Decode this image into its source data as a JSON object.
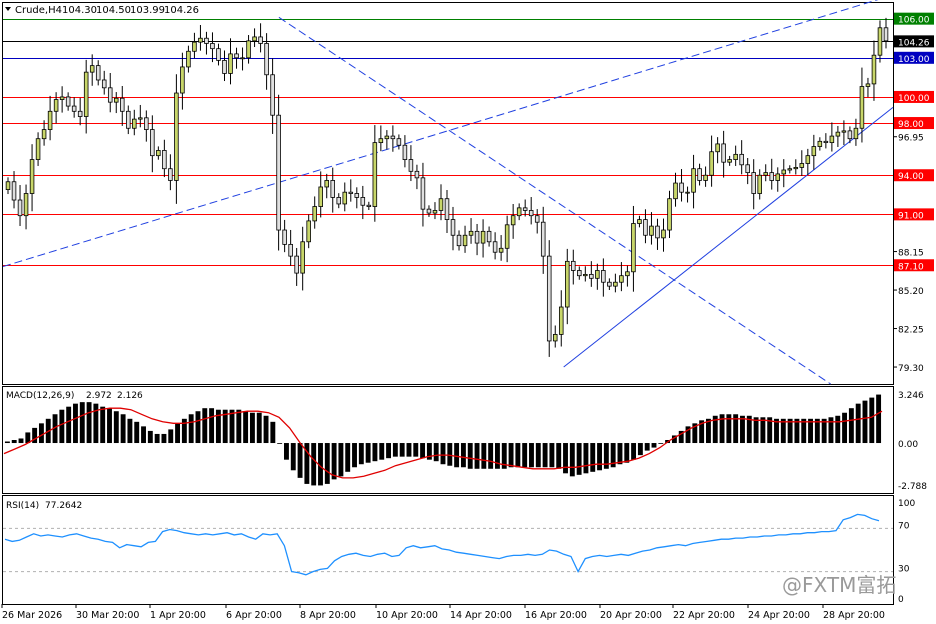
{
  "header": {
    "symbol": "Crude,H4",
    "open": "104.30",
    "high": "104.50",
    "low": "103.99",
    "close": "104.26"
  },
  "watermark": "@FXTM富拓",
  "colors": {
    "bull_body": "#c8d66a",
    "bear_body": "#e0e0e0",
    "candle_outline": "#000000",
    "level_red": "#ff0000",
    "level_blue": "#0000c0",
    "level_green": "#008000",
    "trend_blue": "#2040e0",
    "macd_signal": "#e00000",
    "rsi_line": "#1e90ff"
  },
  "chart_data": [
    {
      "type": "candlestick",
      "title": "Crude,H4",
      "ylim": [
        78.0,
        107.2
      ],
      "y_ticks": [
        "96.95",
        "88.15",
        "85.20",
        "82.25",
        "79.30"
      ],
      "x_ticks": [
        "26 Mar 2026",
        "30 Mar 20:00",
        "1 Apr 20:00",
        "6 Apr 20:00",
        "8 Apr 20:00",
        "10 Apr 20:00",
        "14 Apr 20:00",
        "16 Apr 20:00",
        "20 Apr 20:00",
        "22 Apr 20:00",
        "24 Apr 20:00",
        "28 Apr 20:00"
      ],
      "levels": [
        {
          "value": 106.0,
          "label": "106.00",
          "color": "green"
        },
        {
          "value": 104.26,
          "label": "104.26",
          "color": "black"
        },
        {
          "value": 103.0,
          "label": "103.00",
          "color": "blue"
        },
        {
          "value": 100.0,
          "label": "100.00",
          "color": "red"
        },
        {
          "value": 98.0,
          "label": "98.00",
          "color": "red"
        },
        {
          "value": 94.0,
          "label": "94.00",
          "color": "red"
        },
        {
          "value": 91.0,
          "label": "91.00",
          "color": "red"
        },
        {
          "value": 87.1,
          "label": "87.10",
          "color": "red"
        }
      ],
      "trendlines": [
        {
          "style": "dashed",
          "from": [
            0,
            87.0
          ],
          "to": [
            0.985,
            107.5
          ]
        },
        {
          "style": "dashed",
          "from": [
            0.31,
            106.1
          ],
          "to": [
            0.93,
            78.0
          ]
        },
        {
          "style": "solid",
          "from": [
            0.63,
            79.3
          ],
          "to": [
            1.0,
            99.2
          ]
        }
      ],
      "closes": [
        93.5,
        92.1,
        90.9,
        92.6,
        95.2,
        96.8,
        97.5,
        98.9,
        99.8,
        100.0,
        99.3,
        98.9,
        98.5,
        101.9,
        102.4,
        101.3,
        100.7,
        99.6,
        99.9,
        98.9,
        97.6,
        98.3,
        98.4,
        97.5,
        95.5,
        95.9,
        94.5,
        93.6,
        100.3,
        102.3,
        103.5,
        104.2,
        104.5,
        104.1,
        103.7,
        102.8,
        101.8,
        103.3,
        103.0,
        103.0,
        104.3,
        104.6,
        104.1,
        101.7,
        98.6,
        89.8,
        88.7,
        87.8,
        86.5,
        88.9,
        90.5,
        91.6,
        93.1,
        93.6,
        92.3,
        91.8,
        92.7,
        92.6,
        92.3,
        91.7,
        91.6,
        96.5,
        96.8,
        97.0,
        96.8,
        96.3,
        95.2,
        94.3,
        93.8,
        91.4,
        91.1,
        91.3,
        92.2,
        90.6,
        89.4,
        88.6,
        89.4,
        89.7,
        88.8,
        89.7,
        88.9,
        88.1,
        88.4,
        90.2,
        90.9,
        91.5,
        91.3,
        90.9,
        90.4,
        87.8,
        81.3,
        81.8,
        83.9,
        87.4,
        86.7,
        86.3,
        86.4,
        86.1,
        86.7,
        85.8,
        85.5,
        85.8,
        86.3,
        86.6,
        90.3,
        90.6,
        89.4,
        90.1,
        89.2,
        89.8,
        92.2,
        93.4,
        92.7,
        92.7,
        94.5,
        93.6,
        94.0,
        95.8,
        96.4,
        95.0,
        95.2,
        95.6,
        94.8,
        94.2,
        92.6,
        94.0,
        94.2,
        93.6,
        94.1,
        94.4,
        94.5,
        94.6,
        94.9,
        95.5,
        96.2,
        96.6,
        96.5,
        97.0,
        97.3,
        97.4,
        96.8,
        97.6,
        100.8,
        101.0,
        103.2,
        105.3,
        104.3
      ]
    },
    {
      "type": "bar",
      "title": "MACD(12,26,9)",
      "main_value": "2.972",
      "signal_value": "2.126",
      "ylim": [
        -3.3,
        3.7
      ],
      "y_ticks": [
        "3.246",
        "0.00",
        "-2.788"
      ],
      "series": [
        {
          "name": "MACD",
          "values": [
            0.1,
            0.2,
            0.3,
            0.7,
            1.0,
            1.3,
            1.6,
            1.9,
            2.2,
            2.4,
            2.6,
            2.7,
            2.7,
            2.6,
            2.4,
            2.3,
            2.1,
            1.9,
            1.6,
            1.4,
            1.1,
            0.8,
            0.6,
            0.6,
            0.9,
            1.3,
            1.6,
            1.9,
            2.1,
            2.3,
            2.3,
            2.2,
            2.2,
            2.2,
            2.2,
            2.1,
            2.0,
            2.0,
            1.8,
            1.4,
            0.0,
            -1.1,
            -1.8,
            -2.3,
            -2.7,
            -2.8,
            -2.8,
            -2.7,
            -2.4,
            -2.2,
            -1.9,
            -1.6,
            -1.4,
            -1.3,
            -1.2,
            -1.1,
            -1.0,
            -0.9,
            -0.9,
            -0.9,
            -0.9,
            -1.0,
            -1.1,
            -1.2,
            -1.4,
            -1.5,
            -1.6,
            -1.6,
            -1.7,
            -1.7,
            -1.7,
            -1.7,
            -1.7,
            -1.7,
            -1.6,
            -1.6,
            -1.6,
            -1.6,
            -1.6,
            -1.6,
            -1.6,
            -1.7,
            -2.0,
            -2.2,
            -2.1,
            -2.0,
            -1.9,
            -1.8,
            -1.7,
            -1.6,
            -1.4,
            -1.3,
            -1.1,
            -0.8,
            -0.5,
            -0.3,
            0.0,
            0.2,
            0.5,
            0.8,
            1.1,
            1.3,
            1.5,
            1.6,
            1.8,
            1.9,
            1.9,
            1.9,
            1.8,
            1.8,
            1.7,
            1.7,
            1.7,
            1.6,
            1.6,
            1.6,
            1.6,
            1.6,
            1.6,
            1.6,
            1.6,
            1.7,
            1.8,
            2.0,
            2.3,
            2.6,
            2.8,
            3.0,
            3.2
          ]
        },
        {
          "name": "Signal",
          "values": [
            -0.7,
            -0.4,
            -0.1,
            0.3,
            0.7,
            1.1,
            1.4,
            1.7,
            2.0,
            2.2,
            2.3,
            2.3,
            2.2,
            1.9,
            1.6,
            1.4,
            1.3,
            1.3,
            1.4,
            1.6,
            1.8,
            1.9,
            2.0,
            2.1,
            2.1,
            2.0,
            1.7,
            1.0,
            0.0,
            -0.9,
            -1.6,
            -2.1,
            -2.3,
            -2.3,
            -2.2,
            -2.0,
            -1.8,
            -1.5,
            -1.3,
            -1.1,
            -0.9,
            -0.8,
            -0.8,
            -0.9,
            -1.0,
            -1.1,
            -1.2,
            -1.4,
            -1.5,
            -1.6,
            -1.7,
            -1.7,
            -1.7,
            -1.6,
            -1.6,
            -1.5,
            -1.4,
            -1.4,
            -1.3,
            -1.2,
            -1.0,
            -0.7,
            -0.3,
            0.2,
            0.6,
            1.0,
            1.3,
            1.5,
            1.6,
            1.6,
            1.6,
            1.5,
            1.5,
            1.4,
            1.4,
            1.4,
            1.4,
            1.4,
            1.4,
            1.4,
            1.5,
            1.6,
            1.7,
            2.1
          ]
        }
      ]
    },
    {
      "type": "line",
      "title": "RSI(14)",
      "value": "77.2642",
      "ylim": [
        0,
        100
      ],
      "y_ticks": [
        "100",
        "70",
        "30",
        "0"
      ],
      "series": [
        {
          "name": "RSI",
          "values": [
            60,
            58,
            59,
            62,
            65,
            63,
            64,
            63,
            62,
            64,
            65,
            63,
            61,
            60,
            58,
            57,
            52,
            55,
            54,
            53,
            57,
            58,
            67,
            69,
            68,
            66,
            65,
            64,
            65,
            64,
            65,
            66,
            64,
            65,
            62,
            60,
            65,
            64,
            65,
            54,
            30,
            29,
            27,
            30,
            32,
            33,
            40,
            44,
            46,
            47,
            45,
            44,
            46,
            47,
            44,
            45,
            52,
            54,
            52,
            53,
            54,
            51,
            50,
            48,
            47,
            46,
            45,
            44,
            43,
            42,
            44,
            45,
            45,
            46,
            45,
            46,
            50,
            49,
            46,
            44,
            30,
            42,
            44,
            45,
            44,
            45,
            46,
            45,
            47,
            49,
            50,
            52,
            53,
            54,
            55,
            54,
            56,
            57,
            58,
            59,
            60,
            60,
            61,
            61,
            62,
            62,
            63,
            63,
            64,
            64,
            65,
            65,
            66,
            66,
            67,
            67,
            68,
            78,
            80,
            83,
            82,
            79,
            77
          ]
        }
      ]
    }
  ]
}
